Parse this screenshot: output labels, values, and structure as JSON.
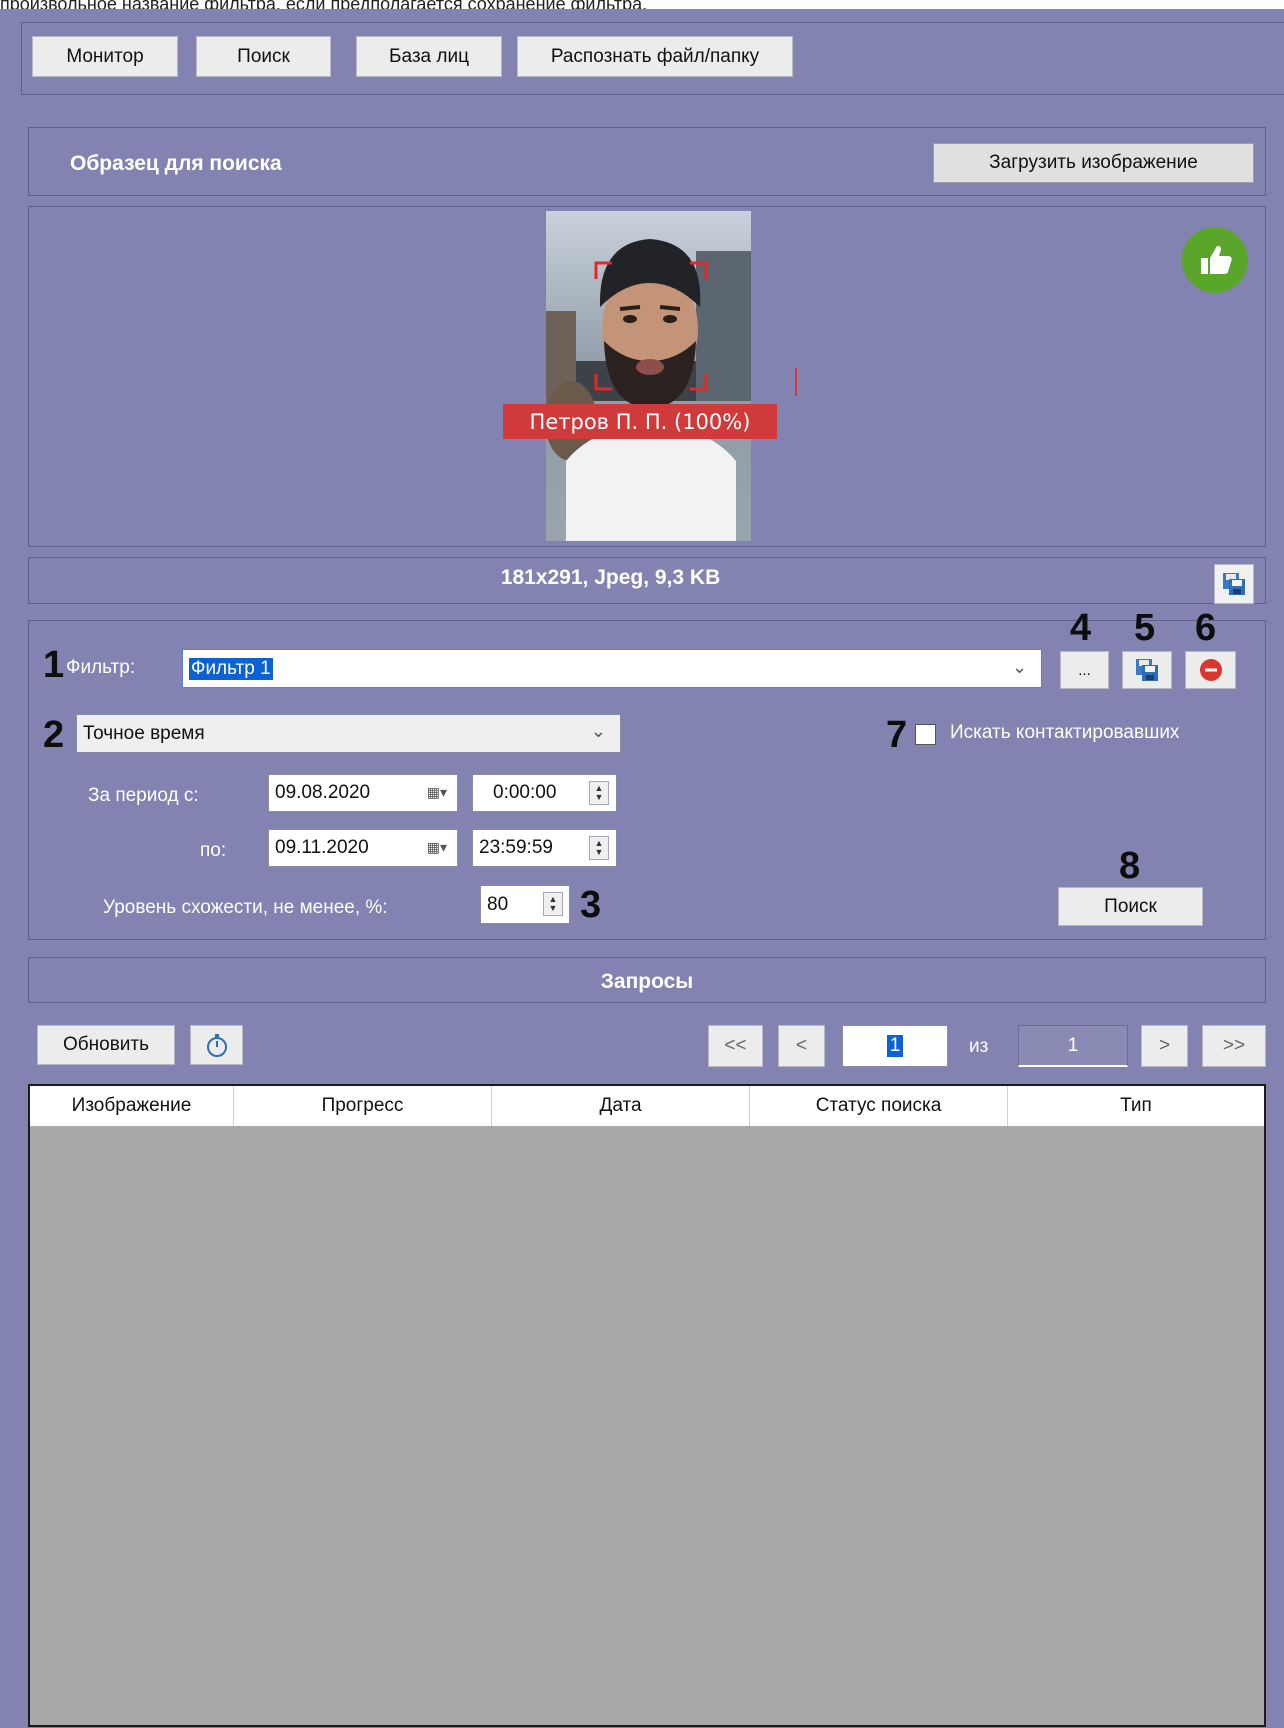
{
  "caption": "произвольное название фильтра, если предполагается сохранение фильтра.",
  "nav": {
    "tabs": [
      {
        "label": "Монитор"
      },
      {
        "label": "Поиск"
      },
      {
        "label": "База лиц"
      },
      {
        "label": "Распознать файл/папку"
      }
    ]
  },
  "sample": {
    "title": "Образец для поиска",
    "load_button": "Загрузить изображение",
    "face_label": "Петров П. П. (100%)",
    "file_info": "181x291, Jpeg, 9,3 KB",
    "thumbs_icon": "thumbs-up-icon",
    "save_icon": "floppy-save-icon"
  },
  "filter": {
    "label": "Фильтр:",
    "value": "Фильтр 1",
    "more_button": "...",
    "time_mode": "Точное время",
    "period_from_label": "За период с:",
    "period_to_label": "по:",
    "from_date": "09.08.2020",
    "from_time": "0:00:00",
    "to_date": "09.11.2020",
    "to_time": "23:59:59",
    "similarity_label": "Уровень схожести, не менее, %:",
    "similarity_value": "80",
    "contacts_label": "Искать контактировавших",
    "contacts_checked": false,
    "search_button": "Поиск"
  },
  "callouts": {
    "n1": "1",
    "n2": "2",
    "n3": "3",
    "n4": "4",
    "n5": "5",
    "n6": "6",
    "n7": "7",
    "n8": "8"
  },
  "requests": {
    "title": "Запросы",
    "refresh_button": "Обновить",
    "pager": {
      "first": "<<",
      "prev": "<",
      "current": "1",
      "of_label": "из",
      "total": "1",
      "next": ">",
      "last": ">>"
    },
    "columns": [
      "Изображение",
      "Прогресс",
      "Дата",
      "Статус поиска",
      "Тип"
    ]
  },
  "colors": {
    "panel": "#8283b0",
    "face_label_bg": "#d03a3a",
    "thumbs_green": "#5aa62a",
    "remove_red": "#d9362e",
    "table_empty": "#a9a9a9"
  }
}
